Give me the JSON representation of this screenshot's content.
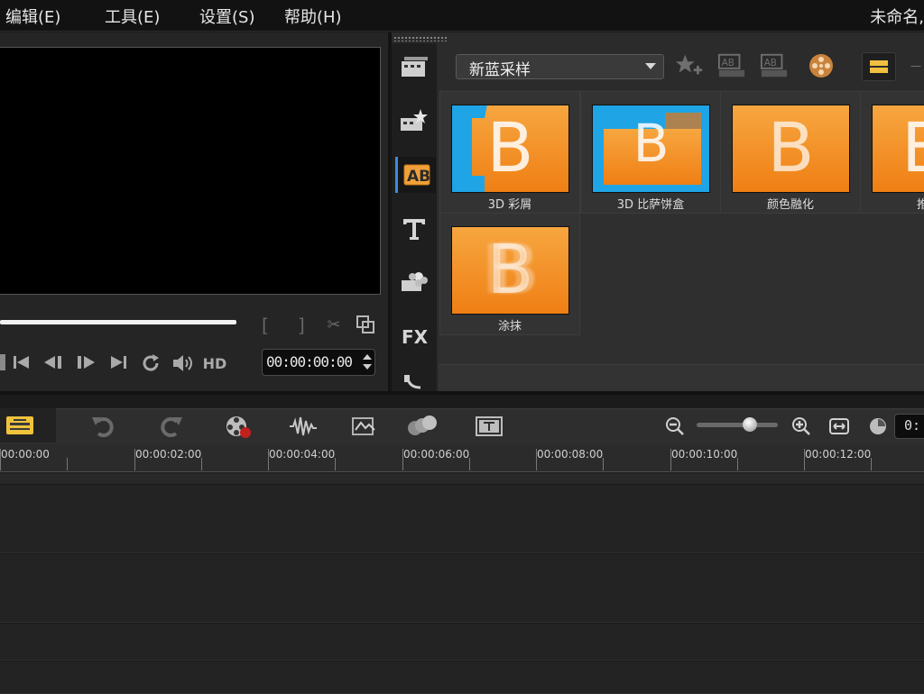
{
  "menubar": {
    "items": [
      "编辑(E)",
      "工具(E)",
      "设置(S)",
      "帮助(H)"
    ],
    "doc_title": "未命名,"
  },
  "player": {
    "timecode": "00:00:00:00",
    "hd_label": "HD"
  },
  "library": {
    "gallery": "新蓝采样",
    "tiles": [
      {
        "label": "3D 彩屑",
        "letter": "B"
      },
      {
        "label": "3D 比萨饼盒",
        "letter": "B"
      },
      {
        "label": "颜色融化",
        "letter": "B"
      },
      {
        "label": "推",
        "letter": "B"
      },
      {
        "label": "涂抹",
        "letter": "B"
      }
    ],
    "categories": [
      "media-icon",
      "instant-project-icon",
      "transition-icon",
      "title-icon",
      "graphic-icon",
      "filter-icon",
      "path-icon"
    ]
  },
  "timeline": {
    "time": "0:",
    "ruler_labels": [
      "00:00:00",
      "00:00:02:00",
      "00:00:04:00",
      "00:00:06:00",
      "00:00:08:00",
      "00:00:10:00",
      "00:00:12:00"
    ]
  },
  "colors": {
    "accent_orange": "#ef8a1e",
    "accent_blue": "#1fa4e6",
    "background": "#1b1b1b"
  }
}
